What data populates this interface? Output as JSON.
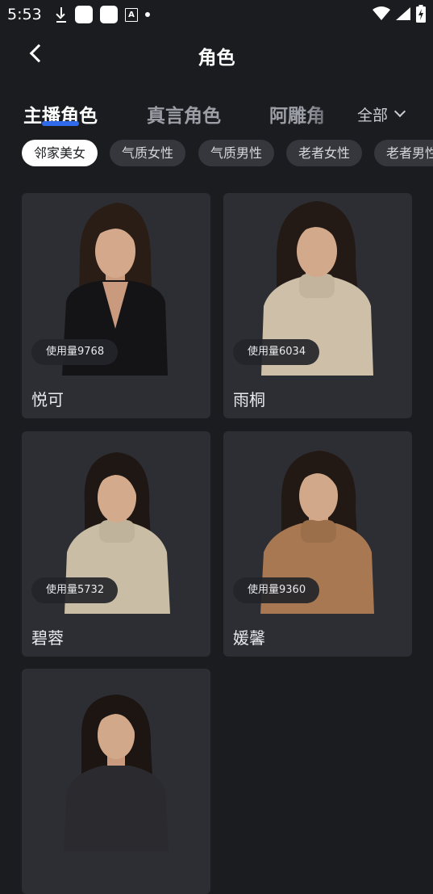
{
  "status": {
    "time": "5:53"
  },
  "header": {
    "title": "角色"
  },
  "tabs": [
    {
      "label": "主播角色",
      "active": true
    },
    {
      "label": "真言角色",
      "active": false
    },
    {
      "label": "阿雕角",
      "active": false
    }
  ],
  "filter": {
    "label": "全部"
  },
  "chips": [
    {
      "label": "邻家美女",
      "active": true
    },
    {
      "label": "气质女性",
      "active": false
    },
    {
      "label": "气质男性",
      "active": false
    },
    {
      "label": "老者女性",
      "active": false
    },
    {
      "label": "老者男性",
      "active": false
    }
  ],
  "cards": [
    {
      "name": "悦可",
      "usage": "使用量9768",
      "sweater": "black"
    },
    {
      "name": "雨桐",
      "usage": "使用量6034",
      "sweater": "beige"
    },
    {
      "name": "碧蓉",
      "usage": "使用量5732",
      "sweater": "beige"
    },
    {
      "name": "媛馨",
      "usage": "使用量9360",
      "sweater": "tan"
    },
    {
      "name": "",
      "usage": "",
      "sweater": "dark"
    }
  ],
  "colors": {
    "background": "#1b1c20",
    "card": "#2d2e33",
    "accent": "#2f6bea"
  }
}
